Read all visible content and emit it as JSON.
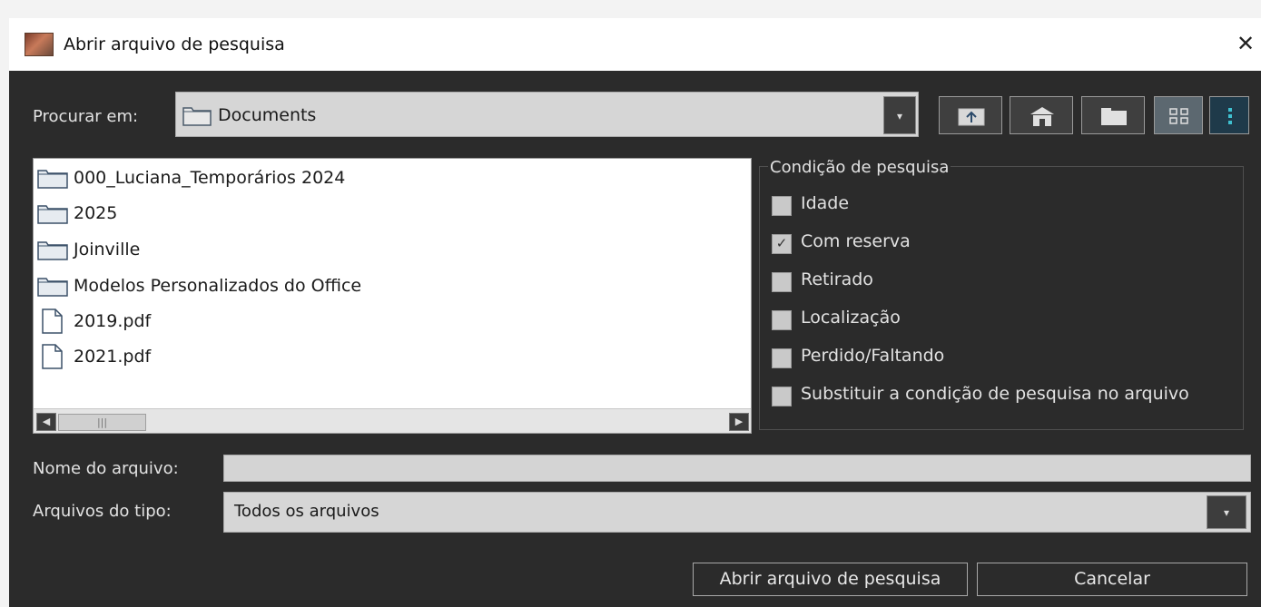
{
  "window": {
    "title": "Abrir arquivo de pesquisa",
    "close_glyph": "✕"
  },
  "look_in": {
    "label": "Procurar em:",
    "value": "Documents",
    "toolbar": [
      "up-folder-icon",
      "home-icon",
      "new-folder-icon",
      "list-view-icon",
      "details-view-icon"
    ]
  },
  "files": [
    {
      "name": "000_Luciana_Temporários 2024",
      "type": "folder"
    },
    {
      "name": "2025",
      "type": "folder"
    },
    {
      "name": "Joinville",
      "type": "folder"
    },
    {
      "name": "Modelos Personalizados do Office",
      "type": "folder"
    },
    {
      "name": "2019.pdf",
      "type": "file"
    },
    {
      "name": "2021.pdf",
      "type": "file"
    }
  ],
  "search_condition": {
    "title": "Condição de pesquisa",
    "options": [
      {
        "label": "Idade",
        "checked": false
      },
      {
        "label": "Com reserva",
        "checked": true
      },
      {
        "label": "Retirado",
        "checked": false
      },
      {
        "label": "Localização",
        "checked": false
      },
      {
        "label": "Perdido/Faltando",
        "checked": false
      },
      {
        "label": "Substituir a condição de pesquisa no arquivo",
        "checked": false
      }
    ]
  },
  "file_name": {
    "label": "Nome do arquivo:",
    "value": ""
  },
  "file_type": {
    "label": "Arquivos do tipo:",
    "value": "Todos os arquivos"
  },
  "buttons": {
    "open": "Abrir arquivo de pesquisa",
    "cancel": "Cancelar"
  }
}
